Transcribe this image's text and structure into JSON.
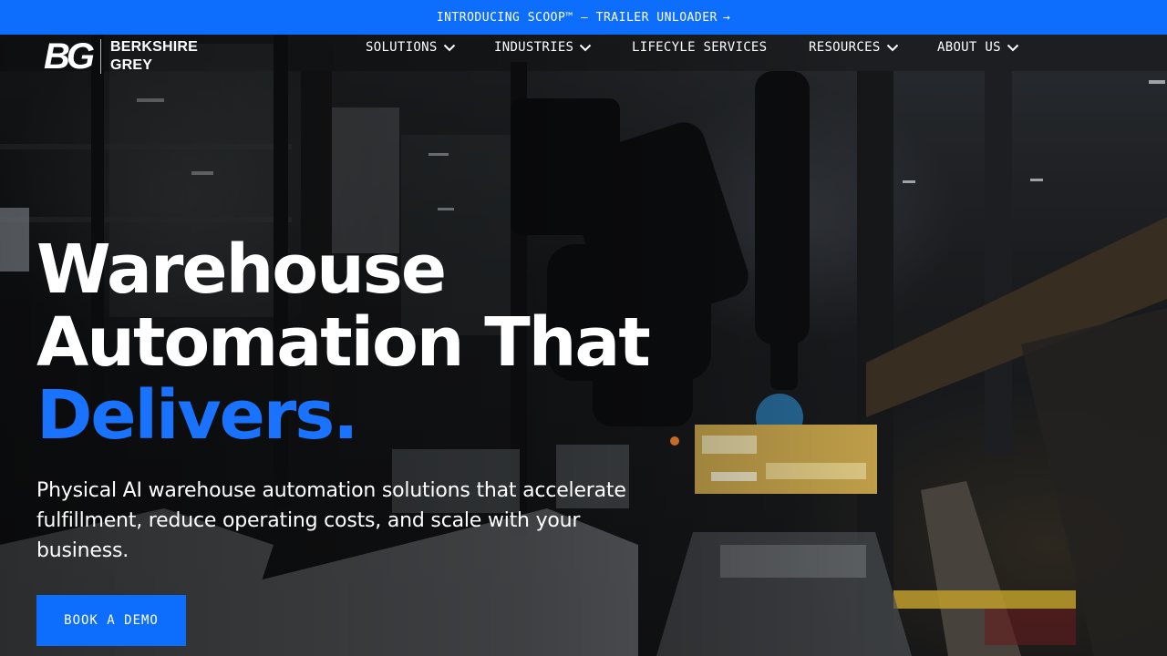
{
  "announcement": {
    "text": "INTRODUCING SCOOP™ — TRAILER UNLOADER",
    "arrow": "→",
    "background": "#0d6efd"
  },
  "logo": {
    "mark": "BG",
    "line1": "BERKSHIRE",
    "line2": "GREY"
  },
  "nav": [
    {
      "label": "SOLUTIONS",
      "icon": "chevron-down-icon"
    },
    {
      "label": "INDUSTRIES",
      "icon": "chevron-down-icon"
    },
    {
      "label": "LIFECYLE SERVICES",
      "icon": null
    },
    {
      "label": "RESOURCES",
      "icon": "chevron-down-icon"
    },
    {
      "label": "ABOUT US",
      "icon": "chevron-down-icon"
    }
  ],
  "hero": {
    "title_line1": "Warehouse",
    "title_line2": "Automation That",
    "title_accent": "Delivers.",
    "accent_color": "#1a73ff",
    "subtitle": "Physical AI warehouse automation solutions that accelerate fulfillment, reduce operating costs, and scale with your business.",
    "cta_label": "BOOK A DEMO"
  }
}
